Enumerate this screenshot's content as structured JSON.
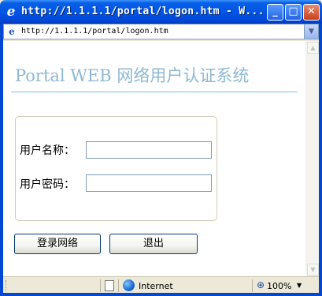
{
  "window": {
    "title": "http://1.1.1.1/portal/logon.htm - W...",
    "minimize_glyph": "_",
    "maximize_glyph": "□",
    "close_glyph": "✕"
  },
  "address_bar": {
    "url": "http://1.1.1.1/portal/logon.htm"
  },
  "page": {
    "title": "Portal WEB 网络用户认证系统",
    "form": {
      "username_label": "用户名称：",
      "username_value": "",
      "password_label": "用户密码：",
      "password_value": ""
    },
    "buttons": {
      "login": "登录网络",
      "logout": "退出"
    }
  },
  "status_bar": {
    "zone": "Internet",
    "zoom": "100%"
  },
  "icons": {
    "browser": "ie-icon",
    "page": "page-icon",
    "zone": "globe-icon",
    "zoom": "magnifier-icon"
  },
  "colors": {
    "titlebar": "#0055E5",
    "page_title": "#8EB8D0",
    "title_rule": "#7FC1DA",
    "input_border": "#7F9DB9",
    "button_border": "#003C74"
  }
}
